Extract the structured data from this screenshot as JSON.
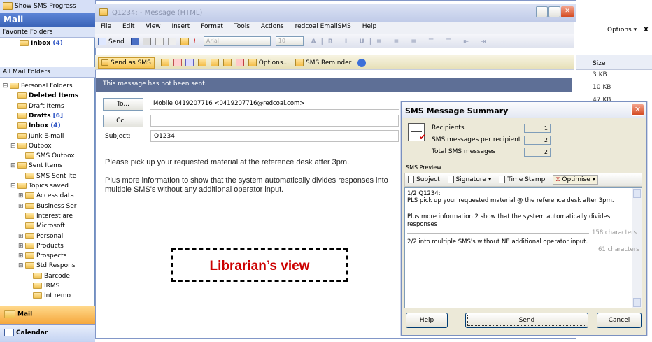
{
  "left": {
    "show_sms": "Show SMS Progress",
    "mail_title": "Mail",
    "favorite_folders": "Favorite Folders",
    "inbox": "Inbox",
    "inbox_count": "(4)",
    "all_mail_folders": "All Mail Folders",
    "folders": [
      {
        "label": "Personal Folders",
        "indent": 0,
        "toggle": "⊟"
      },
      {
        "label": "Deleted Items",
        "indent": 1,
        "bold": true
      },
      {
        "label": "Draft Items",
        "indent": 1
      },
      {
        "label": "Drafts",
        "count": "[6]",
        "indent": 1,
        "bold": true
      },
      {
        "label": "Inbox",
        "count": "(4)",
        "indent": 1,
        "bold": true
      },
      {
        "label": "Junk E-mail",
        "indent": 1
      },
      {
        "label": "Outbox",
        "indent": 1,
        "toggle": "⊟"
      },
      {
        "label": "SMS Outbox",
        "indent": 2
      },
      {
        "label": "Sent Items",
        "indent": 1,
        "toggle": "⊟"
      },
      {
        "label": "SMS Sent Ite",
        "indent": 2
      },
      {
        "label": "Topics saved",
        "indent": 1,
        "toggle": "⊟"
      },
      {
        "label": "Access data",
        "indent": 2,
        "toggle": "⊞"
      },
      {
        "label": "Business Ser",
        "indent": 2,
        "toggle": "⊞"
      },
      {
        "label": "Interest are",
        "indent": 2
      },
      {
        "label": "Microsoft",
        "indent": 2
      },
      {
        "label": "Personal",
        "indent": 2,
        "toggle": "⊞"
      },
      {
        "label": "Products",
        "indent": 2,
        "toggle": "⊞"
      },
      {
        "label": "Prospects",
        "indent": 2,
        "toggle": "⊞"
      },
      {
        "label": "Std Respons",
        "indent": 2,
        "toggle": "⊟"
      },
      {
        "label": "Barcode",
        "indent": 3
      },
      {
        "label": "IRMS",
        "indent": 3
      },
      {
        "label": "Int remo",
        "indent": 3
      }
    ],
    "nav_mail": "Mail",
    "nav_calendar": "Calendar"
  },
  "window": {
    "title": "Q1234: - Message (HTML)",
    "menu": [
      "File",
      "Edit",
      "View",
      "Insert",
      "Format",
      "Tools",
      "Actions",
      "redcoal EmailSMS",
      "Help"
    ],
    "send": "Send",
    "font_name": "Arial",
    "font_size": "10",
    "send_as_sms": "Send as SMS",
    "options": "Options...",
    "sms_reminder": "SMS Reminder",
    "not_sent": "This message has not been sent.",
    "to_label": "To...",
    "to_value": "Mobile 0419207716 <0419207716@redcoal.com>",
    "cc_label": "Cc...",
    "subject_label": "Subject:",
    "subject_value": "Q1234:",
    "body_line1": "Please pick up your requested material at the reference desk after 3pm.",
    "body_line2": "Plus more information to show that the system automatically divides responses into multiple SMS's without any additional operator input.",
    "librarian_label": "Librarian’s view"
  },
  "right": {
    "options": "Options ▾",
    "close": "X",
    "size_header": "Size",
    "sizes": [
      "3 KB",
      "10 KB",
      "47 KB"
    ]
  },
  "dialog": {
    "title": "SMS Message Summary",
    "recipients_label": "Recipients",
    "recipients_value": "1",
    "per_recipient_label": "SMS messages per recipient",
    "per_recipient_value": "2",
    "total_label": "Total SMS messages",
    "total_value": "2",
    "preview_label": "SMS Preview",
    "subject_btn": "Subject",
    "signature_btn": "Signature",
    "timestamp_btn": "Time Stamp",
    "optimise_btn": "Optimise",
    "p1_line1": "1/2 Q1234:",
    "p1_line2": "PLS pick up your requested material @ the reference desk after 3pm.",
    "p1_line3": "Plus more information 2 show that the system automatically divides",
    "p1_line4": "responses",
    "p1_chars": "158 characters",
    "p2_line1": "2/2 into multiple SMS's without NE additional operator input.",
    "p2_chars": "61 characters",
    "help": "Help",
    "send": "Send",
    "cancel": "Cancel"
  }
}
